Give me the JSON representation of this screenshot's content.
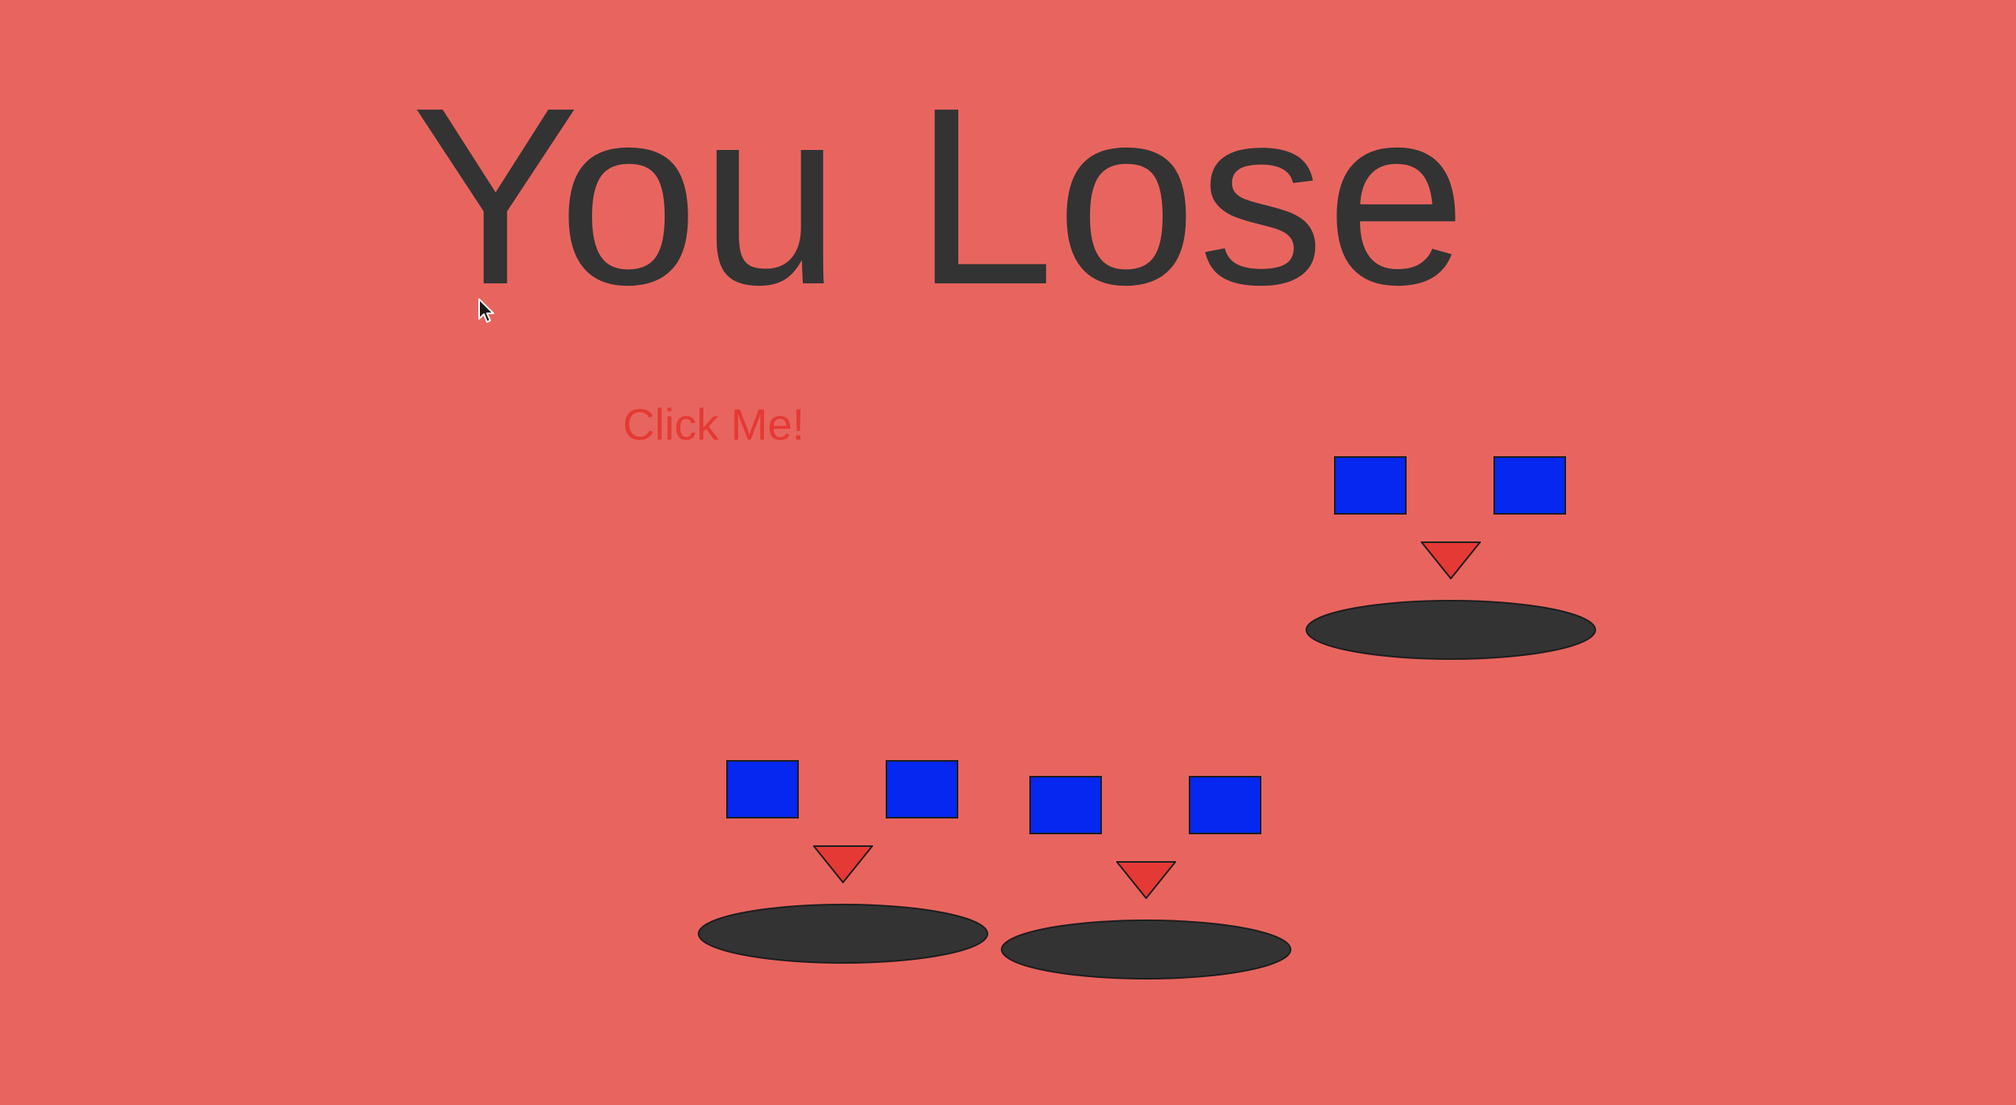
{
  "screen": {
    "title": "You Lose",
    "click_label": "Click Me!"
  },
  "colors": {
    "background": "#e8655f",
    "title_text": "#333333",
    "click_text": "#e53935",
    "eye": "#0527f0",
    "nose": "#e53935",
    "mouth": "#333333",
    "outline": "#1d1d1d"
  },
  "faces": [
    {
      "name": "face-right"
    },
    {
      "name": "face-bottom-left"
    },
    {
      "name": "face-bottom-center"
    }
  ],
  "pointer": {
    "icon": "mouse-cursor-icon"
  }
}
